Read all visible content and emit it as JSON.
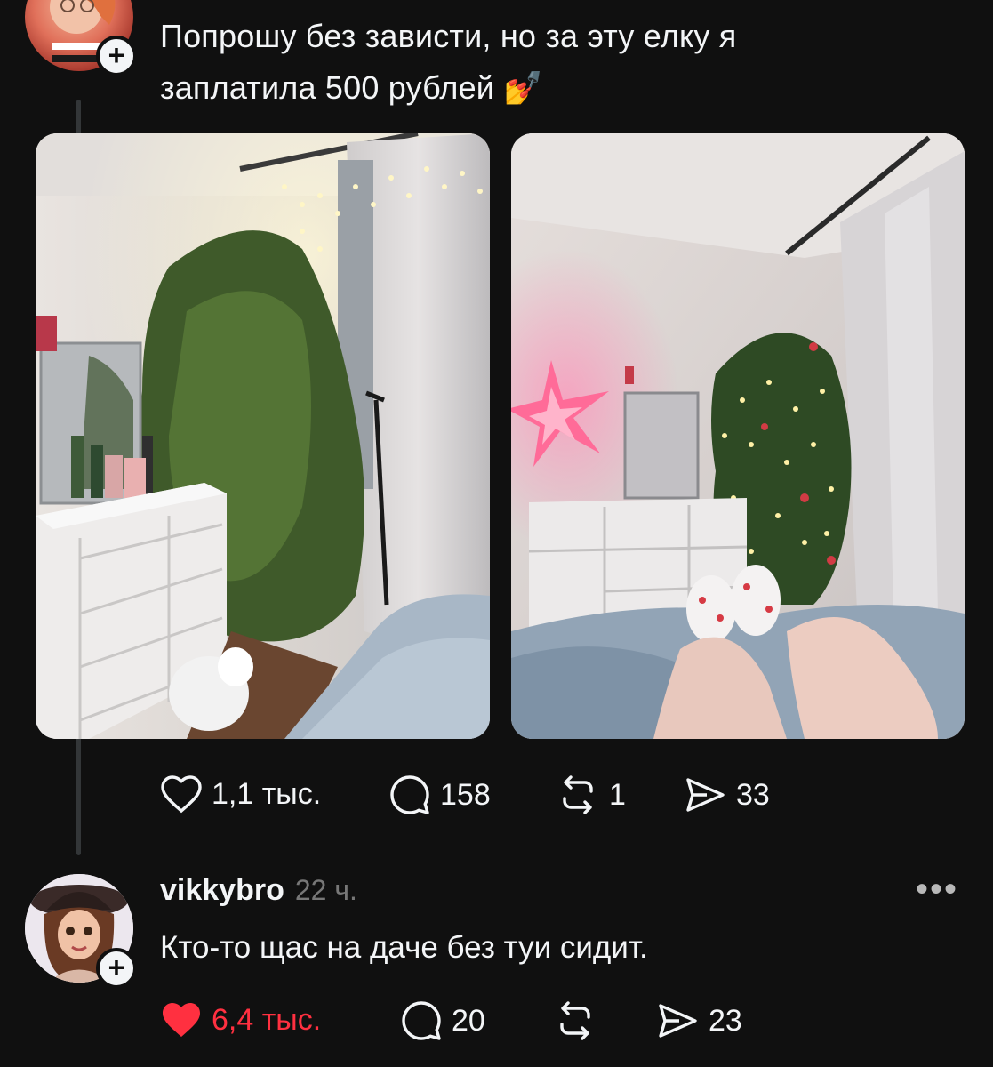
{
  "post": {
    "text_line1": "Попрошу без зависти, но за эту елку я",
    "text_line2": "заплатила 500 рублей",
    "emoji": "💅",
    "stats": {
      "likes": "1,1 тыс.",
      "comments": "158",
      "reposts": "1",
      "shares": "33"
    }
  },
  "reply": {
    "username": "vikkybro",
    "time": "22 ч.",
    "text": "Кто-то щас на даче без туи сидит.",
    "stats": {
      "likes": "6,4 тыс.",
      "comments": "20",
      "reposts": "",
      "shares": "23"
    }
  },
  "icons": {
    "like": "heart-icon",
    "comment": "speech-bubble-icon",
    "repost": "repost-arrows-icon",
    "share": "paper-plane-icon",
    "follow": "plus-icon",
    "more": "ellipsis-icon"
  },
  "colors": {
    "background": "#101010",
    "text": "#f3f5f7",
    "muted": "#777777",
    "liked": "#ff3040"
  }
}
